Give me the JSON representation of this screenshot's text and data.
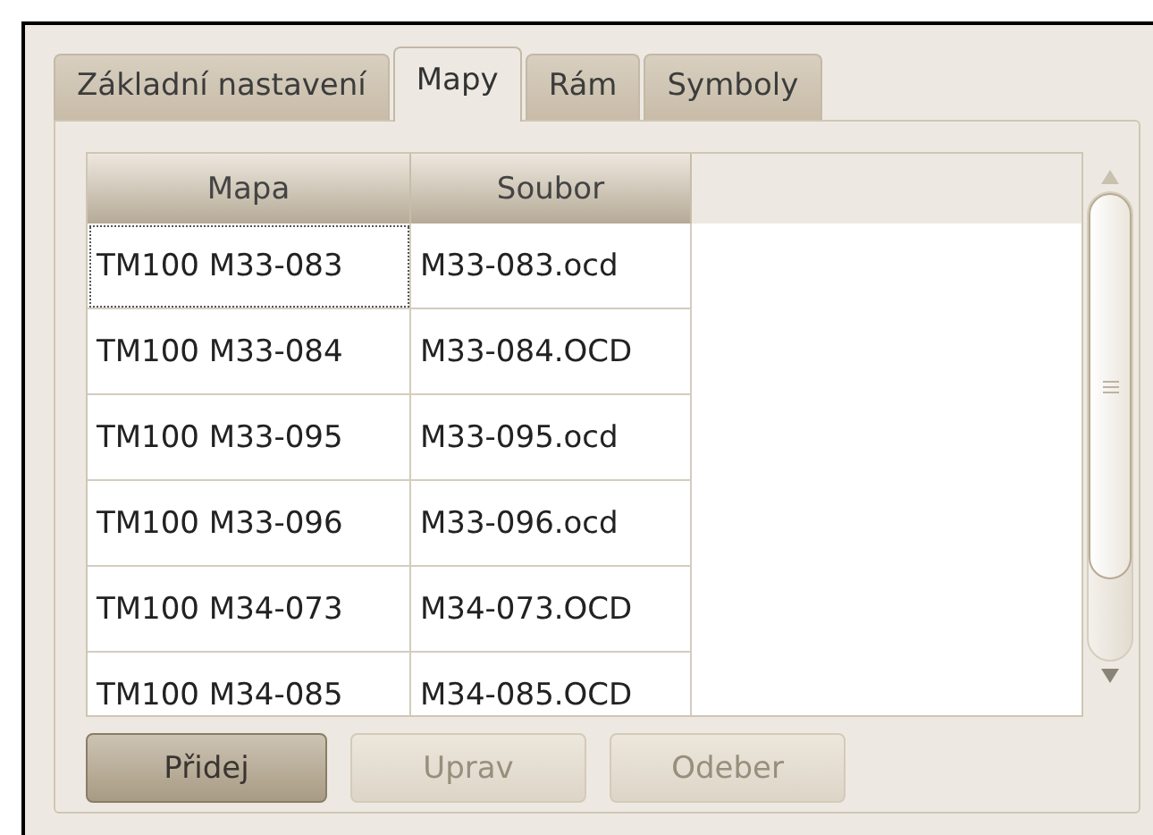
{
  "tabs": [
    {
      "label": "Základní nastavení",
      "selected": false
    },
    {
      "label": "Mapy",
      "selected": true
    },
    {
      "label": "Rám",
      "selected": false
    },
    {
      "label": "Symboly",
      "selected": false
    }
  ],
  "table": {
    "columns": [
      "Mapa",
      "Soubor"
    ],
    "rows": [
      {
        "cells": [
          "TM100 M33-083",
          "M33-083.ocd"
        ],
        "focused": true
      },
      {
        "cells": [
          "TM100 M33-084",
          "M33-084.OCD"
        ],
        "focused": false
      },
      {
        "cells": [
          "TM100 M33-095",
          "M33-095.ocd"
        ],
        "focused": false
      },
      {
        "cells": [
          "TM100 M33-096",
          "M33-096.ocd"
        ],
        "focused": false
      },
      {
        "cells": [
          "TM100 M34-073",
          "M34-073.OCD"
        ],
        "focused": false
      },
      {
        "cells": [
          "TM100 M34-085",
          "M34-085.OCD"
        ],
        "focused": false
      }
    ]
  },
  "buttons": [
    {
      "label": "Přidej",
      "disabled": false
    },
    {
      "label": "Uprav",
      "disabled": true
    },
    {
      "label": "Odeber",
      "disabled": true
    }
  ]
}
